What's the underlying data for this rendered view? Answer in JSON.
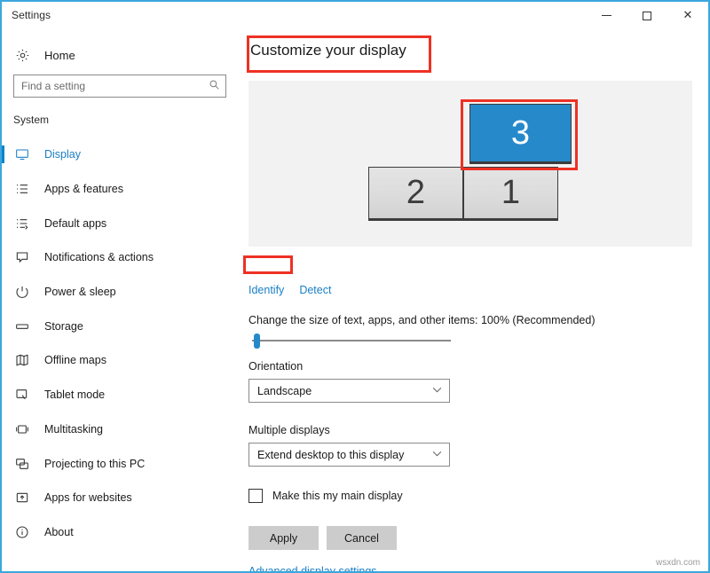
{
  "window": {
    "title": "Settings",
    "controls": {
      "minimize": "minimize-icon",
      "maximize": "maximize-icon",
      "close": "close-icon"
    },
    "border_color": "#3ba7dd"
  },
  "sidebar": {
    "home_label": "Home",
    "home_icon": "gear-icon",
    "search": {
      "placeholder": "Find a setting",
      "value": "",
      "icon": "search-icon"
    },
    "section_label": "System",
    "items": [
      {
        "label": "Display",
        "icon": "monitor-icon",
        "selected": true
      },
      {
        "label": "Apps & features",
        "icon": "list-icon",
        "selected": false
      },
      {
        "label": "Default apps",
        "icon": "list-arrow-icon",
        "selected": false
      },
      {
        "label": "Notifications & actions",
        "icon": "speech-bubble-icon",
        "selected": false
      },
      {
        "label": "Power & sleep",
        "icon": "power-icon",
        "selected": false
      },
      {
        "label": "Storage",
        "icon": "drive-icon",
        "selected": false
      },
      {
        "label": "Offline maps",
        "icon": "map-icon",
        "selected": false
      },
      {
        "label": "Tablet mode",
        "icon": "tablet-touch-icon",
        "selected": false
      },
      {
        "label": "Multitasking",
        "icon": "windows-split-icon",
        "selected": false
      },
      {
        "label": "Projecting to this PC",
        "icon": "project-screen-icon",
        "selected": false
      },
      {
        "label": "Apps for websites",
        "icon": "app-export-icon",
        "selected": false
      },
      {
        "label": "About",
        "icon": "info-icon",
        "selected": false
      }
    ]
  },
  "main": {
    "page_title": "Customize your display",
    "preview": {
      "monitors": [
        {
          "number": "2",
          "state": "inactive"
        },
        {
          "number": "1",
          "state": "inactive"
        },
        {
          "number": "3",
          "state": "active"
        }
      ],
      "active_color": "#2689ca"
    },
    "identify_link": "Identify",
    "detect_link": "Detect",
    "scale_label": "Change the size of text, apps, and other items: 100% (Recommended)",
    "scale_value": "100%",
    "orientation": {
      "label": "Orientation",
      "value": "Landscape",
      "chevron": "chevron-down-icon"
    },
    "multiple_displays": {
      "label": "Multiple displays",
      "value": "Extend desktop to this display",
      "chevron": "chevron-down-icon"
    },
    "main_display_checkbox": {
      "label": "Make this my main display",
      "checked": false
    },
    "apply_label": "Apply",
    "cancel_label": "Cancel",
    "advanced_link": "Advanced display settings"
  },
  "annotations": {
    "color": "#ee3124",
    "boxes": [
      "page-title",
      "monitor-3",
      "identify-link"
    ]
  },
  "watermark": "wsxdn.com"
}
